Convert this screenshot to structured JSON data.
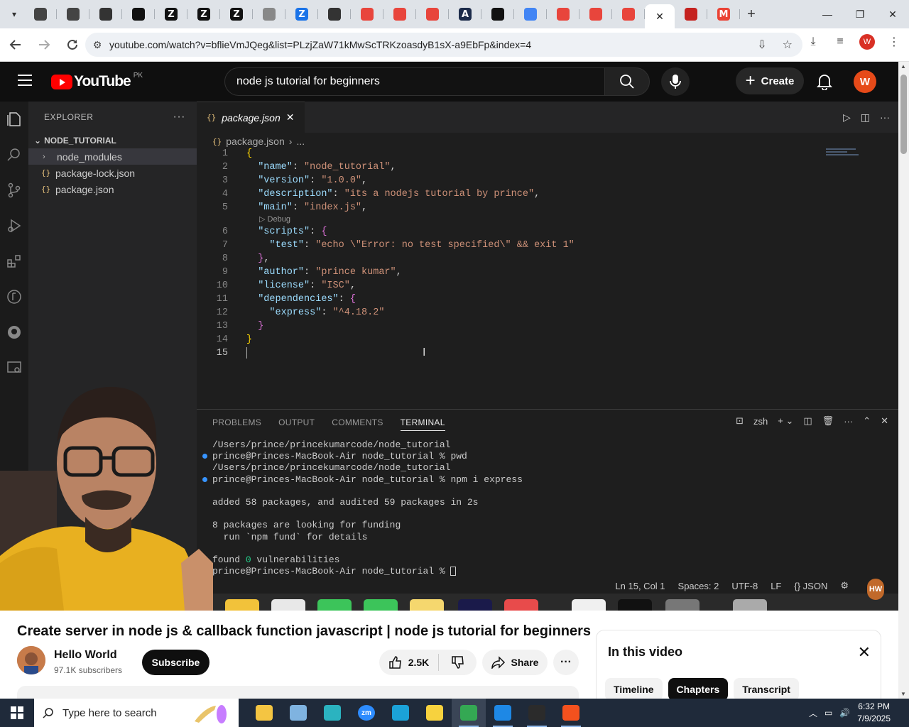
{
  "browser": {
    "tabs": [
      {
        "icon": "dropdown-icon"
      },
      {
        "icon": "image-icon",
        "color": "#444"
      },
      {
        "icon": "image-icon",
        "color": "#444"
      },
      {
        "icon": "globe-icon",
        "color": "#333"
      },
      {
        "icon": "openai-icon",
        "color": "#111"
      },
      {
        "icon": "zlogo-icon",
        "letter": "Z",
        "color": "#111"
      },
      {
        "icon": "zlogo-icon",
        "letter": "Z",
        "color": "#111"
      },
      {
        "icon": "zlogo-icon",
        "letter": "Z",
        "color": "#111"
      },
      {
        "icon": "globe-icon",
        "color": "#888"
      },
      {
        "icon": "zlogo-icon",
        "letter": "Z",
        "color": "#1a73e8"
      },
      {
        "icon": "globe-icon",
        "color": "#333"
      },
      {
        "icon": "ticket-icon",
        "color": "#e8453c"
      },
      {
        "icon": "ticket-icon",
        "color": "#e8453c"
      },
      {
        "icon": "ticket-icon",
        "color": "#e8453c"
      },
      {
        "icon": "anthropic-icon",
        "letter": "A",
        "color": "#1c2b4a"
      },
      {
        "icon": "openai-icon",
        "color": "#111"
      },
      {
        "icon": "gemini-icon",
        "color": "#4285f4"
      },
      {
        "icon": "pen-icon",
        "color": "#e8453c"
      },
      {
        "icon": "pen-icon",
        "color": "#e8453c"
      },
      {
        "icon": "pen-icon",
        "color": "#e8453c"
      }
    ],
    "active_tab_close": "✕",
    "extra_tabs": [
      {
        "icon": "bookmark-icon",
        "color": "#c5221f"
      },
      {
        "icon": "gmail-icon",
        "letter": "M",
        "color": "#ea4335"
      }
    ],
    "new_tab": "+",
    "url": "youtube.com/watch?v=bflieVmJQeg&list=PLzjZaW71kMwScTRKzoasdyB1sX-a9EbFp&index=4",
    "profile_letter": "W"
  },
  "youtube": {
    "logo_text": "YouTube",
    "country": "PK",
    "search_value": "node js tutorial for beginners",
    "create_label": "Create",
    "avatar_letter": "W"
  },
  "vscode": {
    "explorer_title": "EXPLORER",
    "project": "NODE_TUTORIAL",
    "files": [
      {
        "name": "node_modules",
        "type": "folder"
      },
      {
        "name": "package-lock.json",
        "type": "json"
      },
      {
        "name": "package.json",
        "type": "json"
      }
    ],
    "active_tab": "package.json",
    "breadcrumb": "package.json",
    "breadcrumb_more": "...",
    "debug_lens": "Debug",
    "code_lines": [
      {
        "n": "1",
        "html": "<span class='b1'>{</span>"
      },
      {
        "n": "2",
        "html": "  <span class='k'>\"name\"</span><span class='p'>: </span><span class='s'>\"node_tutorial\"</span><span class='p'>,</span>"
      },
      {
        "n": "3",
        "html": "  <span class='k'>\"version\"</span><span class='p'>: </span><span class='s'>\"1.0.0\"</span><span class='p'>,</span>"
      },
      {
        "n": "4",
        "html": "  <span class='k'>\"description\"</span><span class='p'>: </span><span class='s'>\"its a nodejs tutorial by prince\"</span><span class='p'>,</span>"
      },
      {
        "n": "5",
        "html": "  <span class='k'>\"main\"</span><span class='p'>: </span><span class='s'>\"index.js\"</span><span class='p'>,</span>"
      },
      {
        "n": "6",
        "html": "  <span class='k'>\"scripts\"</span><span class='p'>: </span><span class='b2'>{</span>"
      },
      {
        "n": "7",
        "html": "    <span class='k'>\"test\"</span><span class='p'>: </span><span class='s'>\"echo \\\"Error: no test specified\\\" &amp;&amp; exit 1\"</span>"
      },
      {
        "n": "8",
        "html": "  <span class='b2'>}</span><span class='p'>,</span>"
      },
      {
        "n": "9",
        "html": "  <span class='k'>\"author\"</span><span class='p'>: </span><span class='s'>\"prince kumar\"</span><span class='p'>,</span>"
      },
      {
        "n": "10",
        "html": "  <span class='k'>\"license\"</span><span class='p'>: </span><span class='s'>\"ISC\"</span><span class='p'>,</span>"
      },
      {
        "n": "11",
        "html": "  <span class='k'>\"dependencies\"</span><span class='p'>: </span><span class='b2'>{</span>"
      },
      {
        "n": "12",
        "html": "    <span class='k'>\"express\"</span><span class='p'>: </span><span class='s'>\"^4.18.2\"</span>"
      },
      {
        "n": "13",
        "html": "  <span class='b2'>}</span>"
      },
      {
        "n": "14",
        "html": "<span class='b1'>}</span>"
      },
      {
        "n": "15",
        "html": "<span class='caret'></span>"
      }
    ],
    "panel_tabs": [
      "PROBLEMS",
      "OUTPUT",
      "COMMENTS",
      "TERMINAL"
    ],
    "active_panel_tab": "TERMINAL",
    "shell": "zsh",
    "terminal_lines": [
      {
        "dot": "",
        "text": "/Users/prince/princekumarcode/node_tutorial"
      },
      {
        "dot": "blue",
        "text": "prince@Princes-MacBook-Air node_tutorial % pwd"
      },
      {
        "dot": "",
        "text": "/Users/prince/princekumarcode/node_tutorial"
      },
      {
        "dot": "blue",
        "text": "prince@Princes-MacBook-Air node_tutorial % npm i express"
      },
      {
        "dot": "",
        "text": ""
      },
      {
        "dot": "",
        "text": "added 58 packages, and audited 59 packages in 2s"
      },
      {
        "dot": "",
        "text": ""
      },
      {
        "dot": "",
        "text": "8 packages are looking for funding"
      },
      {
        "dot": "",
        "text": "  run `npm fund` for details"
      },
      {
        "dot": "",
        "text": ""
      },
      {
        "dot": "",
        "text": "found <span class='g'>0</span> vulnerabilities"
      },
      {
        "dot": "gray",
        "text": "prince@Princes-MacBook-Air node_tutorial % <span class='cursor'></span>"
      }
    ],
    "status": {
      "position": "Ln 15, Col 1",
      "spaces": "Spaces: 2",
      "encoding": "UTF-8",
      "eol": "LF",
      "language": "{} JSON"
    },
    "badge": "HW"
  },
  "video": {
    "title": "Create server in node js & callback function javascript | node js tutorial for beginners",
    "channel": "Hello World",
    "subscribers": "97.1K subscribers",
    "subscribe_label": "Subscribe",
    "likes": "2.5K",
    "share_label": "Share",
    "more_label": "···"
  },
  "chapters": {
    "heading": "In this video",
    "close": "✕",
    "chips": [
      "Timeline",
      "Chapters",
      "Transcript"
    ],
    "selected": "Chapters"
  },
  "taskbar": {
    "search_placeholder": "Type here to search",
    "apps": [
      {
        "icon": "file-explorer-icon",
        "color": "#f4c542"
      },
      {
        "icon": "paint-icon",
        "color": "#7fb3e0"
      },
      {
        "icon": "app-diamond-icon",
        "color": "#2bb3c0"
      },
      {
        "icon": "zoom-icon",
        "color": "#2d8cff",
        "label": "zm"
      },
      {
        "icon": "edge-icon",
        "color": "#1ba2d8"
      },
      {
        "icon": "sticky-notes-icon",
        "color": "#f7d23e"
      },
      {
        "icon": "chrome-icon",
        "color": "#34a853",
        "active": true
      },
      {
        "icon": "vscode-icon",
        "color": "#1e88e5"
      },
      {
        "icon": "terminal-icon",
        "color": "#2b2b2b"
      },
      {
        "icon": "brave-pen-icon",
        "color": "#f4511e"
      }
    ],
    "time": "6:32 PM",
    "date": "7/9/2025"
  }
}
